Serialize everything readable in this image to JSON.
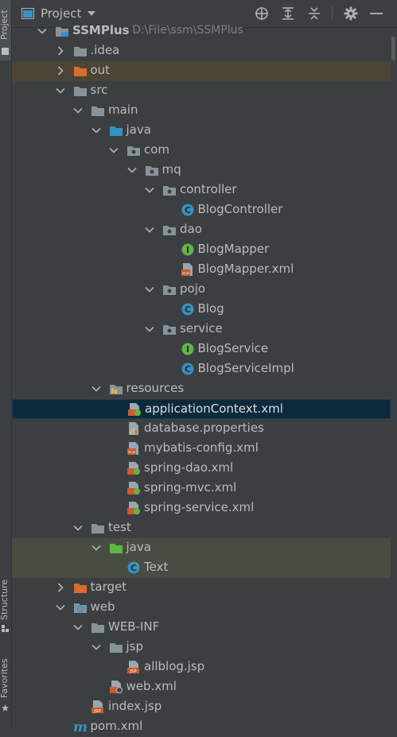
{
  "header": {
    "title": "Project",
    "tools": [
      "locate-icon",
      "expand-all-icon",
      "collapse-all-icon",
      "gear-icon",
      "minimize-icon"
    ]
  },
  "side_tabs": {
    "project": "Project",
    "structure": "Structure",
    "favorites": "Favorites"
  },
  "colors": {
    "folder": "#87939a",
    "source_folder": "#3592c4",
    "excluded_folder": "#d86d2d",
    "test_folder": "#62b543",
    "class_badge": "#3592c4",
    "interface_badge": "#62b543",
    "xml_badge": "#cc5a2c",
    "selected_row": "#0d293e"
  },
  "tree": [
    {
      "depth": 0,
      "expanded": true,
      "icon": "module-icon",
      "label": "SSMPlus",
      "sub": "D:\\File\\ssm\\SSMPlus",
      "bold": true
    },
    {
      "depth": 1,
      "expanded": false,
      "icon": "folder-icon",
      "label": ".idea"
    },
    {
      "depth": 1,
      "expanded": false,
      "icon": "excluded-folder-icon",
      "label": "out",
      "state": "excluded"
    },
    {
      "depth": 1,
      "expanded": true,
      "icon": "folder-icon",
      "label": "src"
    },
    {
      "depth": 2,
      "expanded": true,
      "icon": "folder-icon",
      "label": "main"
    },
    {
      "depth": 3,
      "expanded": true,
      "icon": "source-folder-icon",
      "label": "java"
    },
    {
      "depth": 4,
      "expanded": true,
      "icon": "package-icon",
      "label": "com"
    },
    {
      "depth": 5,
      "expanded": true,
      "icon": "package-icon",
      "label": "mq"
    },
    {
      "depth": 6,
      "expanded": true,
      "icon": "package-icon",
      "label": "controller"
    },
    {
      "depth": 7,
      "icon": "class-icon",
      "label": "BlogController"
    },
    {
      "depth": 6,
      "expanded": true,
      "icon": "package-icon",
      "label": "dao"
    },
    {
      "depth": 7,
      "icon": "interface-icon",
      "label": "BlogMapper"
    },
    {
      "depth": 7,
      "icon": "xml-file-icon",
      "label": "BlogMapper.xml"
    },
    {
      "depth": 6,
      "expanded": true,
      "icon": "package-icon",
      "label": "pojo"
    },
    {
      "depth": 7,
      "icon": "class-icon",
      "label": "Blog"
    },
    {
      "depth": 6,
      "expanded": true,
      "icon": "package-icon",
      "label": "service"
    },
    {
      "depth": 7,
      "icon": "interface-icon",
      "label": "BlogService"
    },
    {
      "depth": 7,
      "icon": "class-icon",
      "label": "BlogServiceImpl"
    },
    {
      "depth": 3,
      "expanded": true,
      "icon": "resources-folder-icon",
      "label": "resources"
    },
    {
      "depth": 4,
      "icon": "spring-xml-icon",
      "label": "applicationContext.xml",
      "state": "selected"
    },
    {
      "depth": 4,
      "icon": "properties-file-icon",
      "label": "database.properties"
    },
    {
      "depth": 4,
      "icon": "xml-file-icon",
      "label": "mybatis-config.xml"
    },
    {
      "depth": 4,
      "icon": "spring-xml-icon",
      "label": "spring-dao.xml"
    },
    {
      "depth": 4,
      "icon": "spring-xml-icon",
      "label": "spring-mvc.xml"
    },
    {
      "depth": 4,
      "icon": "spring-xml-icon",
      "label": "spring-service.xml"
    },
    {
      "depth": 2,
      "expanded": true,
      "icon": "folder-icon",
      "label": "test"
    },
    {
      "depth": 3,
      "expanded": true,
      "icon": "test-folder-icon",
      "label": "java",
      "state": "test"
    },
    {
      "depth": 4,
      "icon": "test-class-icon",
      "label": "Text",
      "state": "test"
    },
    {
      "depth": 1,
      "expanded": false,
      "icon": "excluded-folder-icon",
      "label": "target"
    },
    {
      "depth": 1,
      "expanded": true,
      "icon": "web-folder-icon",
      "label": "web"
    },
    {
      "depth": 2,
      "expanded": true,
      "icon": "folder-icon",
      "label": "WEB-INF"
    },
    {
      "depth": 3,
      "expanded": true,
      "icon": "folder-icon",
      "label": "jsp"
    },
    {
      "depth": 4,
      "icon": "jsp-file-icon",
      "label": "allblog.jsp"
    },
    {
      "depth": 3,
      "icon": "web-xml-icon",
      "label": "web.xml"
    },
    {
      "depth": 2,
      "icon": "jsp-file-icon",
      "label": "index.jsp"
    },
    {
      "depth": 1,
      "icon": "maven-icon",
      "label": "pom.xml"
    }
  ]
}
